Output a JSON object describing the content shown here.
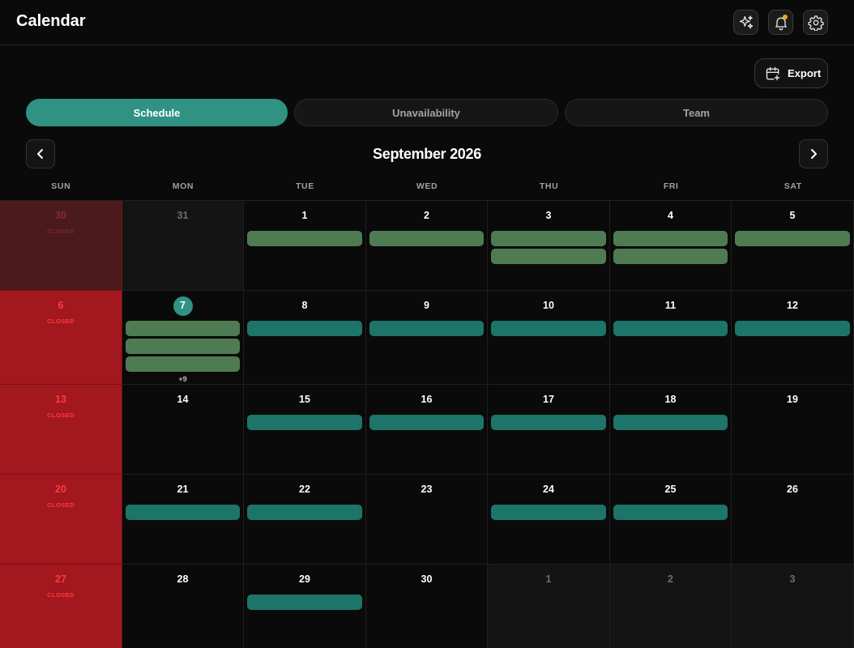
{
  "app": {
    "title": "Calendar"
  },
  "header": {
    "icons": [
      {
        "name": "sparkles-icon",
        "has_dot": false
      },
      {
        "name": "bell-icon",
        "has_dot": true
      },
      {
        "name": "gear-icon",
        "has_dot": false
      }
    ]
  },
  "toolbar": {
    "export_label": "Export",
    "export_icon": "calendar-plus-icon"
  },
  "tabs": [
    {
      "label": "Schedule",
      "active": true
    },
    {
      "label": "Unavailability",
      "active": false
    },
    {
      "label": "Team",
      "active": false
    }
  ],
  "calendar": {
    "month_label": "September 2026",
    "weekdays": [
      "SUN",
      "MON",
      "TUE",
      "WED",
      "THU",
      "FRI",
      "SAT"
    ],
    "closed_label": "CLOSED",
    "colors": {
      "accent": "#2f9283",
      "event_green": "#4f7b52",
      "event_teal": "#1d7468",
      "closed": "#a3171f"
    },
    "weeks": [
      [
        {
          "day": "30",
          "other_month": true,
          "closed": true,
          "events": []
        },
        {
          "day": "31",
          "other_month": true,
          "events": []
        },
        {
          "day": "1",
          "events": [
            "green"
          ]
        },
        {
          "day": "2",
          "events": [
            "green"
          ]
        },
        {
          "day": "3",
          "events": [
            "green",
            "green"
          ]
        },
        {
          "day": "4",
          "events": [
            "green",
            "green"
          ]
        },
        {
          "day": "5",
          "events": [
            "green"
          ]
        }
      ],
      [
        {
          "day": "6",
          "closed": true,
          "events": []
        },
        {
          "day": "7",
          "today": true,
          "events": [
            "green",
            "green",
            "green"
          ],
          "more": "+9"
        },
        {
          "day": "8",
          "events": [
            "teal"
          ]
        },
        {
          "day": "9",
          "events": [
            "teal"
          ]
        },
        {
          "day": "10",
          "events": [
            "teal"
          ]
        },
        {
          "day": "11",
          "events": [
            "teal"
          ]
        },
        {
          "day": "12",
          "events": [
            "teal"
          ]
        }
      ],
      [
        {
          "day": "13",
          "closed": true,
          "events": []
        },
        {
          "day": "14",
          "events": []
        },
        {
          "day": "15",
          "events": [
            "teal"
          ]
        },
        {
          "day": "16",
          "events": [
            "teal"
          ]
        },
        {
          "day": "17",
          "events": [
            "teal"
          ]
        },
        {
          "day": "18",
          "events": [
            "teal"
          ]
        },
        {
          "day": "19",
          "events": []
        }
      ],
      [
        {
          "day": "20",
          "closed": true,
          "events": []
        },
        {
          "day": "21",
          "events": [
            "teal"
          ]
        },
        {
          "day": "22",
          "events": [
            "teal"
          ]
        },
        {
          "day": "23",
          "events": []
        },
        {
          "day": "24",
          "events": [
            "teal"
          ]
        },
        {
          "day": "25",
          "events": [
            "teal"
          ]
        },
        {
          "day": "26",
          "events": []
        }
      ],
      [
        {
          "day": "27",
          "closed": true,
          "events": []
        },
        {
          "day": "28",
          "events": []
        },
        {
          "day": "29",
          "events": [
            "teal"
          ]
        },
        {
          "day": "30",
          "events": []
        },
        {
          "day": "1",
          "other_month": true,
          "events": []
        },
        {
          "day": "2",
          "other_month": true,
          "events": []
        },
        {
          "day": "3",
          "other_month": true,
          "events": []
        }
      ]
    ]
  }
}
